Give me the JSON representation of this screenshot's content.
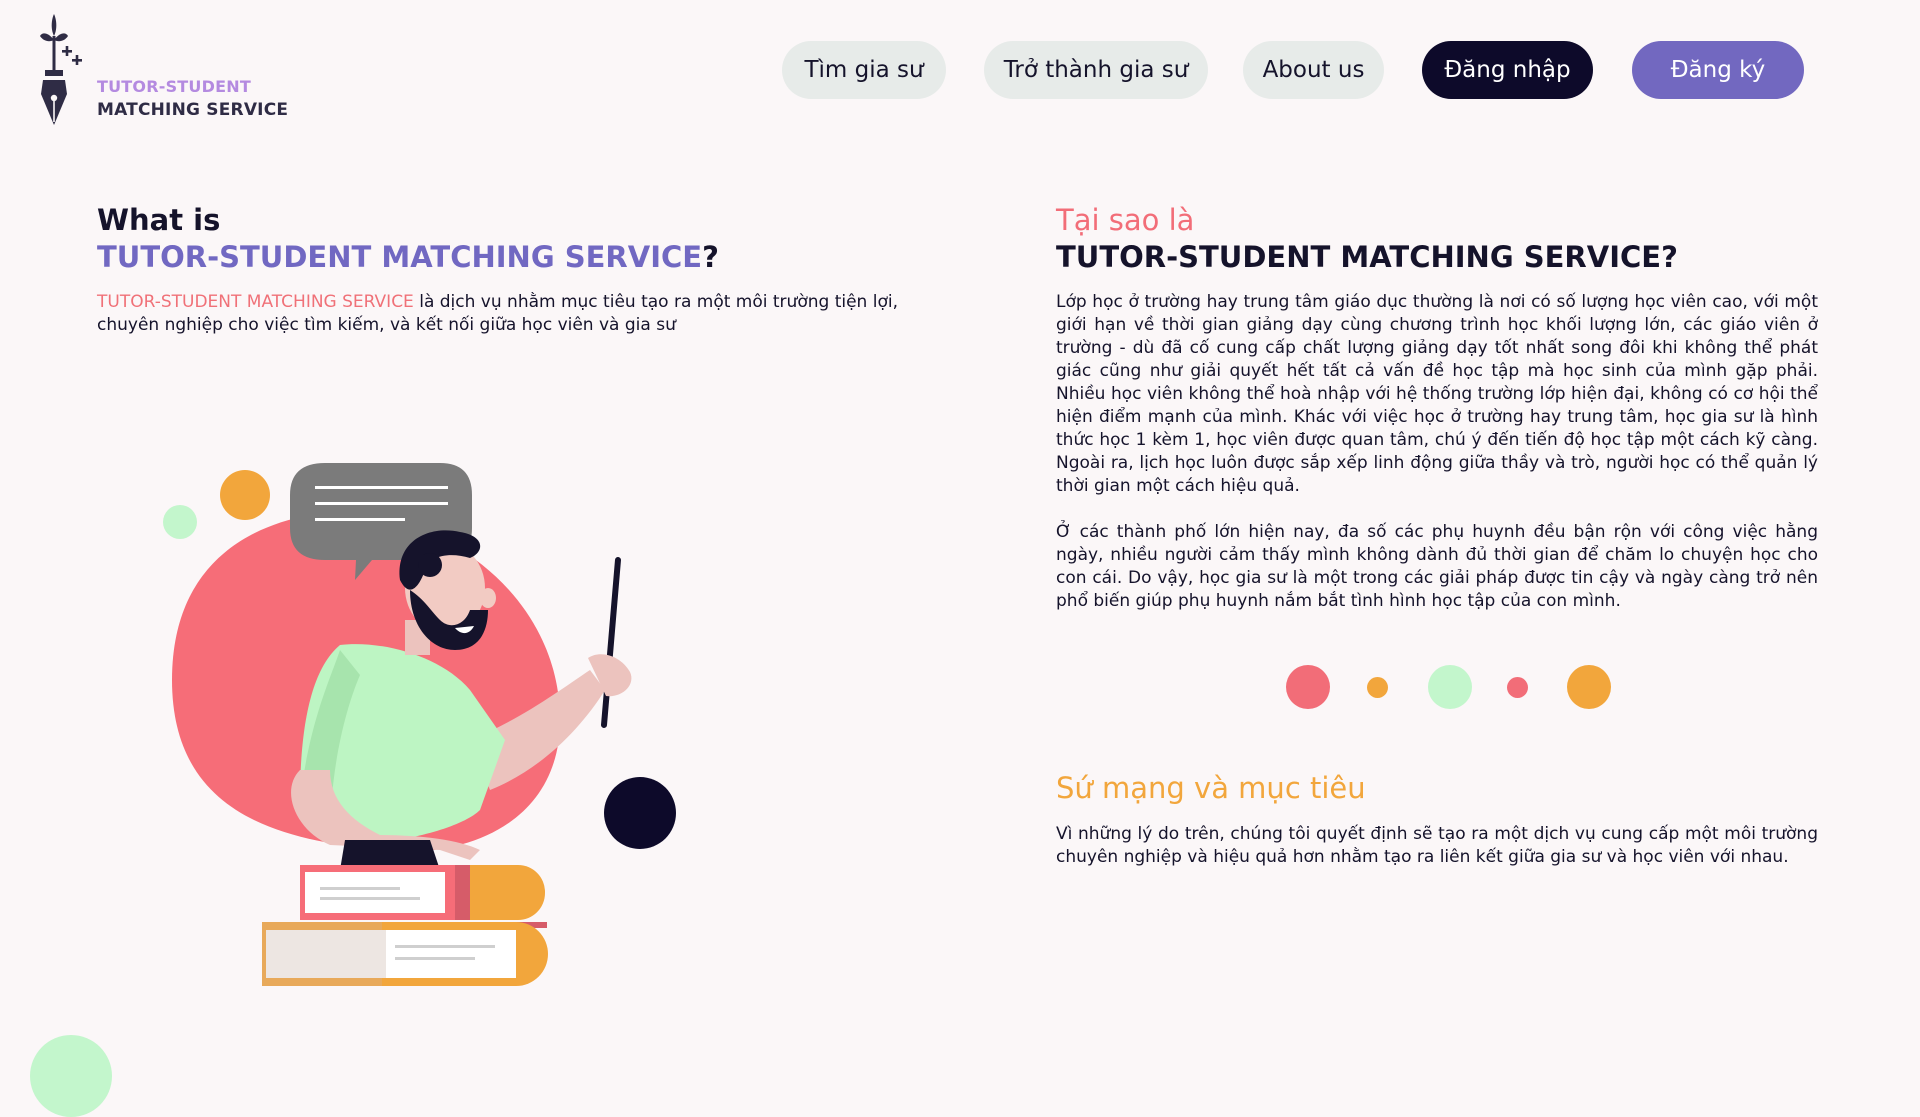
{
  "header": {
    "logo": {
      "line1": "TUTOR-STUDENT",
      "line2": "MATCHING SERVICE"
    },
    "nav": [
      {
        "label": "Tìm gia sư"
      },
      {
        "label": "Trở thành gia sư"
      },
      {
        "label": "About us"
      },
      {
        "label": "Đăng nhập"
      },
      {
        "label": "Đăng ký"
      }
    ]
  },
  "what": {
    "title_prefix": "What is",
    "title_accent": "TUTOR-STUDENT MATCHING SERVICE",
    "title_suffix": "?",
    "desc_highlight": "TUTOR-STUDENT MATCHING SERVICE",
    "desc_rest": " là dịch vụ nhằm mục tiêu tạo ra một môi trường tiện lợi, chuyên nghiệp cho việc tìm kiếm, và kết nối giữa học viên và gia sư"
  },
  "why": {
    "title1": "Tại sao là",
    "title2": "TUTOR-STUDENT MATCHING SERVICE?",
    "paragraphs": [
      "Lớp học ở trường hay trung tâm giáo dục thường là nơi có số lượng học viên cao, với một giới hạn về thời gian giảng dạy cùng chương trình học khối lượng lớn, các giáo viên ở trường - dù đã cố cung cấp chất lượng giảng dạy tốt nhất song đôi khi không thể phát giác cũng như giải quyết hết tất cả vấn đề học tập mà học sinh của mình gặp phải. Nhiều học viên không thể hoà nhập với hệ thống trường lớp hiện đại, không có cơ hội thể hiện điểm mạnh của mình. Khác với việc học ở trường hay trung tâm, học gia sư là hình thức học 1 kèm 1, học viên được quan tâm, chú ý đến tiến độ học tập một cách kỹ càng. Ngoài ra, lịch học luôn được sắp xếp linh động giữa thầy và trò, người học có thể quản lý thời gian một cách hiệu quả.",
      "Ở các thành phố lớn hiện nay, đa số các phụ huynh đều bận rộn với công việc hằng ngày, nhiều người cảm thấy mình không dành đủ thời gian để chăm lo chuyện học cho con cái. Do vậy, học gia sư là một trong các giải pháp được tin cậy và ngày càng trở nên phổ biến giúp phụ huynh nắm bắt tình hình học tập của con mình."
    ]
  },
  "mission": {
    "title": "Sứ mạng và mục tiêu",
    "body": "Vì những lý do trên, chúng tôi quyết định sẽ tạo ra một dịch vụ cung cấp một môi trường chuyên nghiệp và hiệu quả hơn nhằm tạo ra liên kết giữa gia sư và học viên với nhau."
  },
  "colors": {
    "background": "#fbf7f8",
    "primary_purple": "#7168c2",
    "coral": "#f26d78",
    "orange": "#f2a63c",
    "mint": "#c3f6cc",
    "navy": "#0d0a2a"
  },
  "icons": [
    "pen-plant-logo-icon"
  ]
}
